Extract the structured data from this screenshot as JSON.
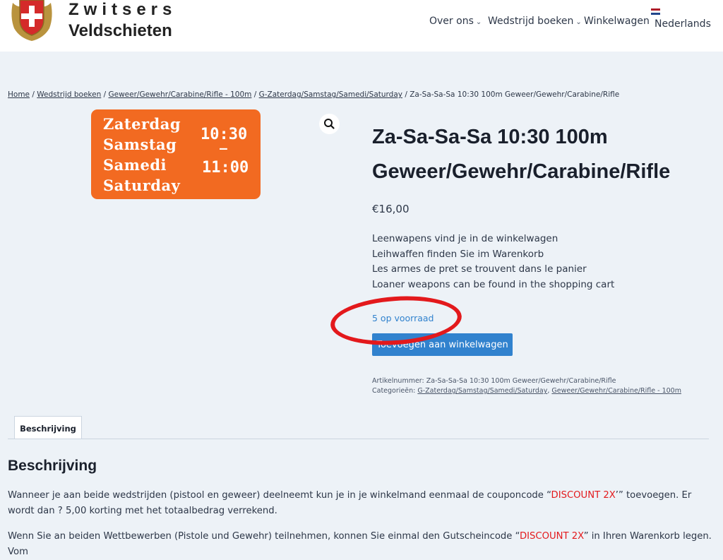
{
  "header": {
    "logo_line1": "Zwitsers",
    "logo_line2": "Veldschieten",
    "nav": [
      {
        "label": "Over ons",
        "has_dropdown": true
      },
      {
        "label": "Wedstrijd boeken",
        "has_dropdown": true
      },
      {
        "label": "Winkelwagen",
        "has_dropdown": false
      },
      {
        "label": "Nederlands",
        "has_dropdown": false
      }
    ]
  },
  "breadcrumb": {
    "items": [
      "Home",
      "Wedstrijd boeken",
      "Geweer/Gewehr/Carabine/Rifle - 100m",
      "G-Zaterdag/Samstag/Samedi/Saturday"
    ],
    "current": "Za-Sa-Sa-Sa 10:30 100m Geweer/Gewehr/Carabine/Rifle",
    "separator": "/"
  },
  "product_image": {
    "days": [
      "Zaterdag",
      "Samstag",
      "Samedi",
      "Saturday"
    ],
    "time_start": "10:30",
    "time_dash": "–",
    "time_end": "11:00",
    "bg_color": "#f26a21"
  },
  "product": {
    "title": "Za-Sa-Sa-Sa 10:30 100m Geweer/Gewehr/Carabine/Rifle",
    "price": "€16,00",
    "description": [
      "Leenwapens vind je in de winkelwagen",
      "Leihwaffen finden Sie im Warenkorb",
      "Les armes de pret se trouvent dans le panier",
      "Loaner weapons can be found in the shopping cart"
    ],
    "stock": "5 op voorraad",
    "add_to_cart": "Toevoegen aan winkelwagen",
    "sku_label": "Artikelnummer:",
    "sku": "Za-Sa-Sa-Sa 10:30 100m Geweer/Gewehr/Carabine/Rifle",
    "categories_label": "Categorieën:",
    "categories": [
      "G-Zaterdag/Samstag/Samedi/Saturday",
      "Geweer/Gewehr/Carabine/Rifle - 100m"
    ]
  },
  "tabs": {
    "active": "Beschrijving"
  },
  "description_section": {
    "title": "Beschrijving",
    "p1_before": "Wanneer je aan beide wedstrijden (pistool en geweer) deelneemt kun je in je winkelmand eenmaal de couponcode “",
    "p1_code": "DISCOUNT 2X",
    "p1_after": "’” toevoegen. Er wordt dan ? 5,00 korting met het totaalbedrag verrekend.",
    "p2_before": "Wenn Sie an beiden Wettbewerben (Pistole und Gewehr) teilnehmen, konnen Sie einmal den Gutscheincode “",
    "p2_code": "DISCOUNT 2X",
    "p2_after": "” in Ihren Warenkorb legen. Vom"
  },
  "colors": {
    "accent": "#3182ce",
    "highlight": "#e3191c",
    "background": "#edf2f7"
  }
}
